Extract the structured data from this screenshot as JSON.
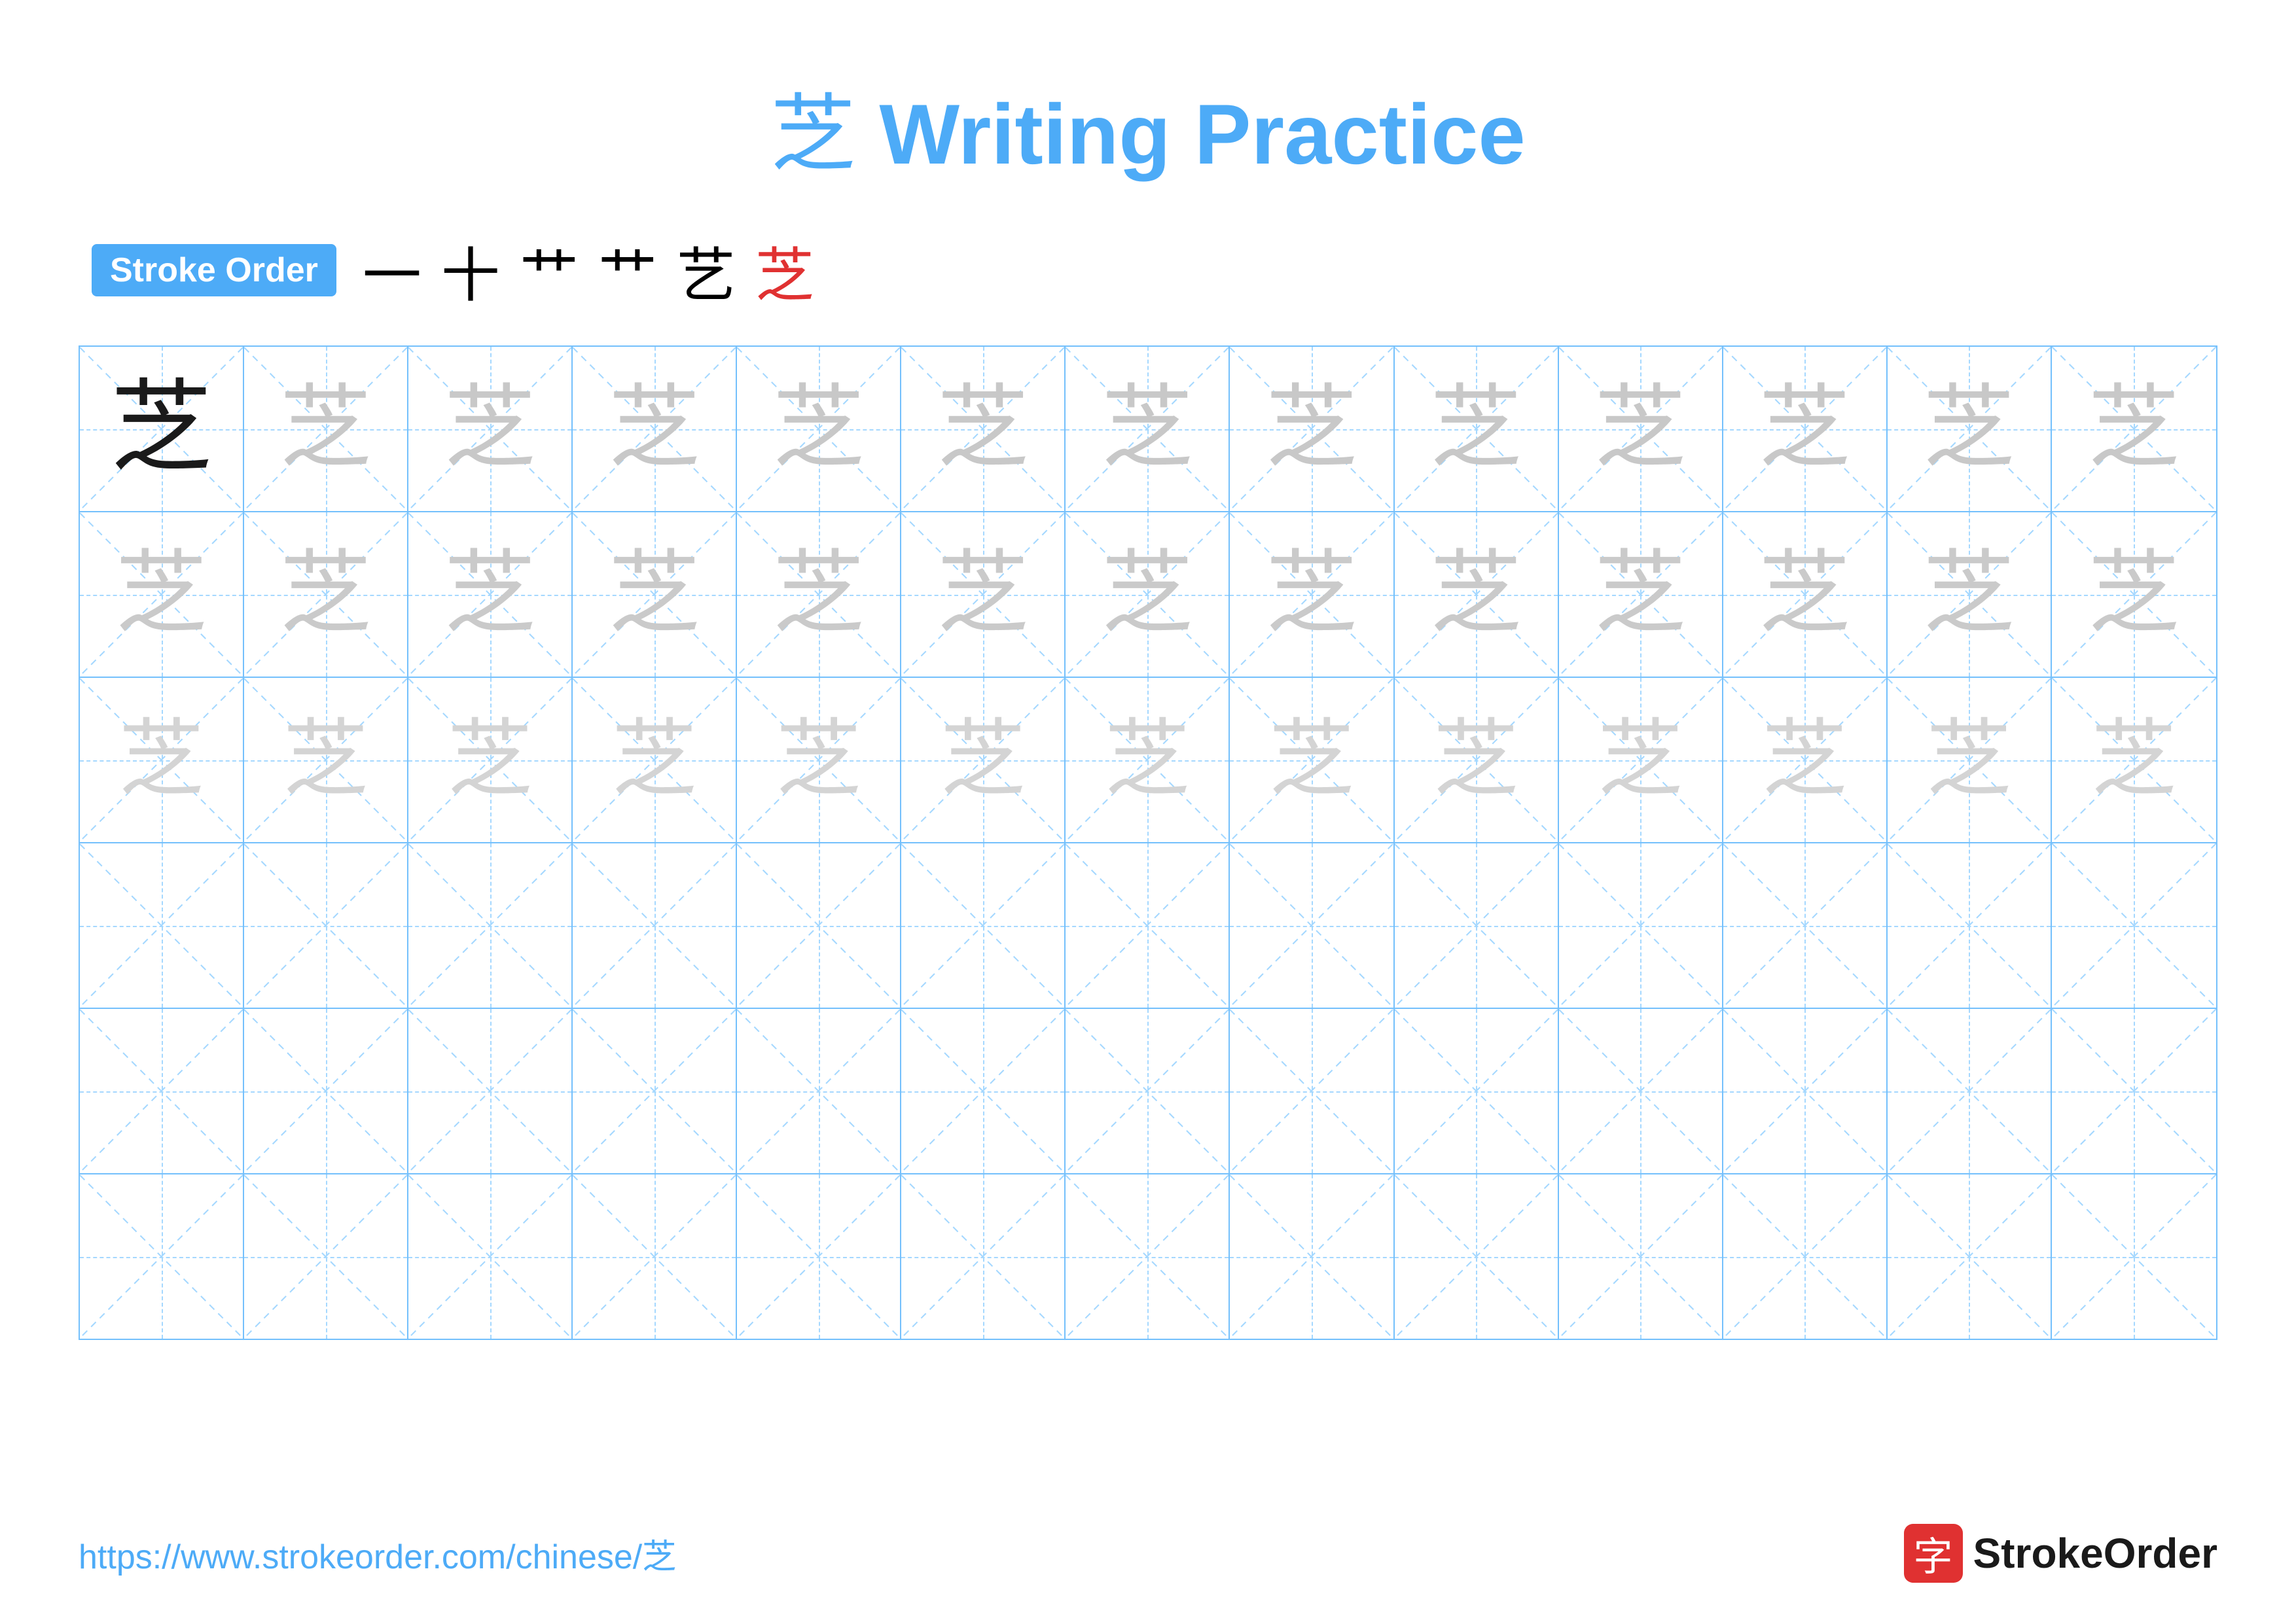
{
  "title": {
    "chinese_char": "芝",
    "text": " Writing Practice"
  },
  "stroke_order": {
    "badge_label": "Stroke Order",
    "strokes": [
      "一",
      "十",
      "艹",
      "艹",
      "艺",
      "芝"
    ]
  },
  "grid": {
    "rows": 6,
    "cols": 13,
    "row_types": [
      "solid_then_ghost",
      "ghost",
      "ghost",
      "empty",
      "empty",
      "empty"
    ]
  },
  "footer": {
    "url": "https://www.strokeorder.com/chinese/芝",
    "logo_char": "字",
    "logo_text": "StrokeOrder"
  }
}
